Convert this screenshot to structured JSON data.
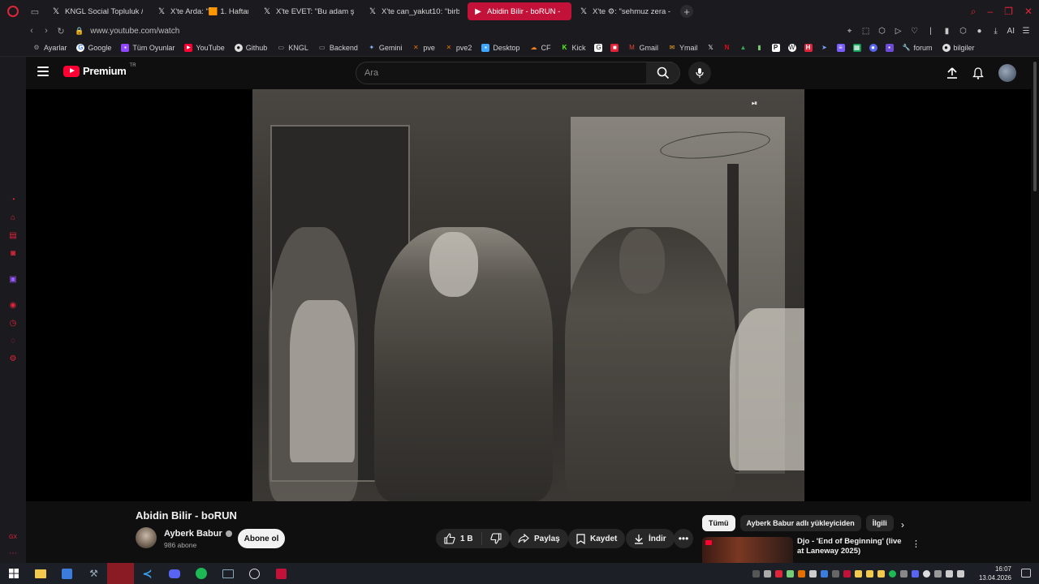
{
  "browser": {
    "tabs": [
      {
        "label": "KNGL Social Topluluk / X",
        "icon": "x-icon",
        "active": false
      },
      {
        "label": "X'te Arda: \"🟧 1. Haftanın",
        "icon": "x-icon",
        "active": false
      },
      {
        "label": "X'te EVET: \"Bu adam şehr",
        "icon": "x-icon",
        "active": false
      },
      {
        "label": "X'te can_yakut10: \"birbirin",
        "icon": "x-icon",
        "active": false
      },
      {
        "label": "Abidin Bilir - boRUN -",
        "icon": "youtube-icon",
        "active": true
      },
      {
        "label": "X'te ⚙: \"sehmuz zera - bu",
        "icon": "x-icon",
        "active": false
      }
    ],
    "url": "www.youtube.com/watch",
    "accent_color": "#e0243a",
    "bookmarks": [
      {
        "label": "Ayarlar",
        "icon": "gear-icon",
        "color": "#888888"
      },
      {
        "label": "Google",
        "icon": "google-icon",
        "color": "#4285f4"
      },
      {
        "label": "Tüm Oyunlar",
        "icon": "games-icon",
        "color": "#9146ff"
      },
      {
        "label": "YouTube",
        "icon": "youtube-icon",
        "color": "#ff0033"
      },
      {
        "label": "Github",
        "icon": "github-icon",
        "color": "#dddddd"
      },
      {
        "label": "KNGL",
        "icon": "folder-icon",
        "color": "#aaaaaa"
      },
      {
        "label": "Backend",
        "icon": "folder-icon",
        "color": "#aaaaaa"
      },
      {
        "label": "Gemini",
        "icon": "gemini-icon",
        "color": "#8ab4f8"
      },
      {
        "label": "pve",
        "icon": "proxmox-icon",
        "color": "#e57000"
      },
      {
        "label": "pve2",
        "icon": "proxmox-icon",
        "color": "#e57000"
      },
      {
        "label": "Desktop",
        "icon": "desktop-icon",
        "color": "#3ea6ff"
      },
      {
        "label": "CF",
        "icon": "cloudflare-icon",
        "color": "#f38020"
      },
      {
        "label": "Kick",
        "icon": "kick-icon",
        "color": "#53fc18"
      },
      {
        "label": "Gmail",
        "icon": "gmail-icon",
        "color": "#ea4335"
      },
      {
        "label": "Ymail",
        "icon": "mail-icon",
        "color": "#f5a623"
      },
      {
        "label": "forum",
        "icon": "wrench-icon",
        "color": "#7aa2ff"
      },
      {
        "label": "bilgiler",
        "icon": "github-icon",
        "color": "#dddddd"
      }
    ],
    "ai_label": "AI"
  },
  "youtube": {
    "brand": "Premium",
    "region": "TR",
    "search_placeholder": "Ara",
    "video": {
      "title": "Abidin Bilir - boRUN",
      "channel": "Ayberk Babur",
      "subscribers": "986 abone",
      "subscribe_label": "Abone ol",
      "likes": "1 B",
      "share_label": "Paylaş",
      "save_label": "Kaydet",
      "download_label": "İndir"
    },
    "chips": [
      "Tümü",
      "Ayberk Babur adlı yükleyiciden",
      "İlgili"
    ],
    "recommendation": {
      "title": "Djo - 'End of Beginning' (live at Laneway 2025)"
    }
  },
  "taskbar": {
    "time": "16:07",
    "date": "13.04.2026"
  }
}
